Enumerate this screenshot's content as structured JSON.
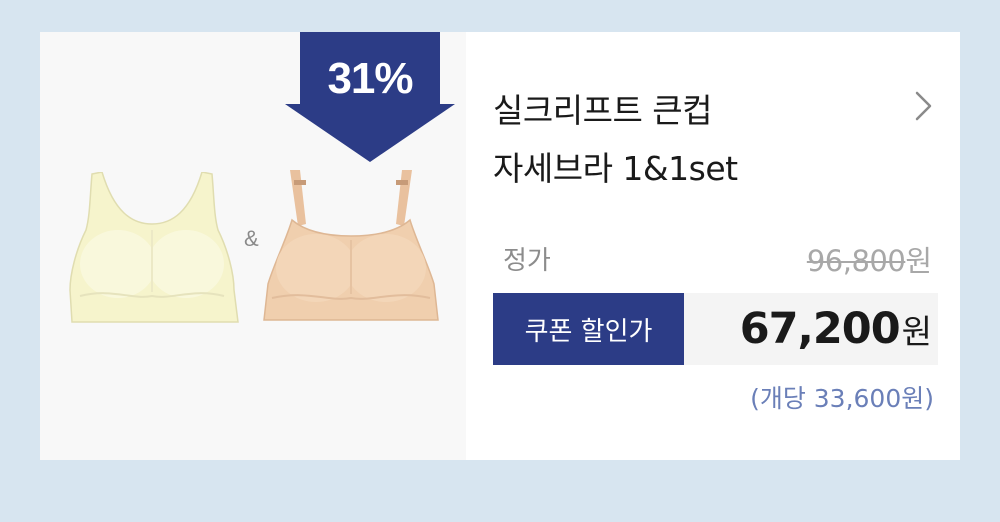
{
  "product": {
    "discount_badge": "31%",
    "amp": "&",
    "title_line1": "실크리프트 큰컵",
    "title_line2": "자세브라 1&1set",
    "regular_price_label": "정가",
    "regular_price": "96,800",
    "regular_price_unit": "원",
    "coupon_label": "쿠폰 할인가",
    "coupon_price": "67,200",
    "coupon_price_unit": "원",
    "unit_price_text": "(개당 33,600원)"
  },
  "colors": {
    "badge": "#2c3c86",
    "coupon_bg": "#2c3c86",
    "bra_yellow": "#f7f6cf",
    "bra_beige": "#f0cfae",
    "unit_price": "#6a7fb8"
  }
}
